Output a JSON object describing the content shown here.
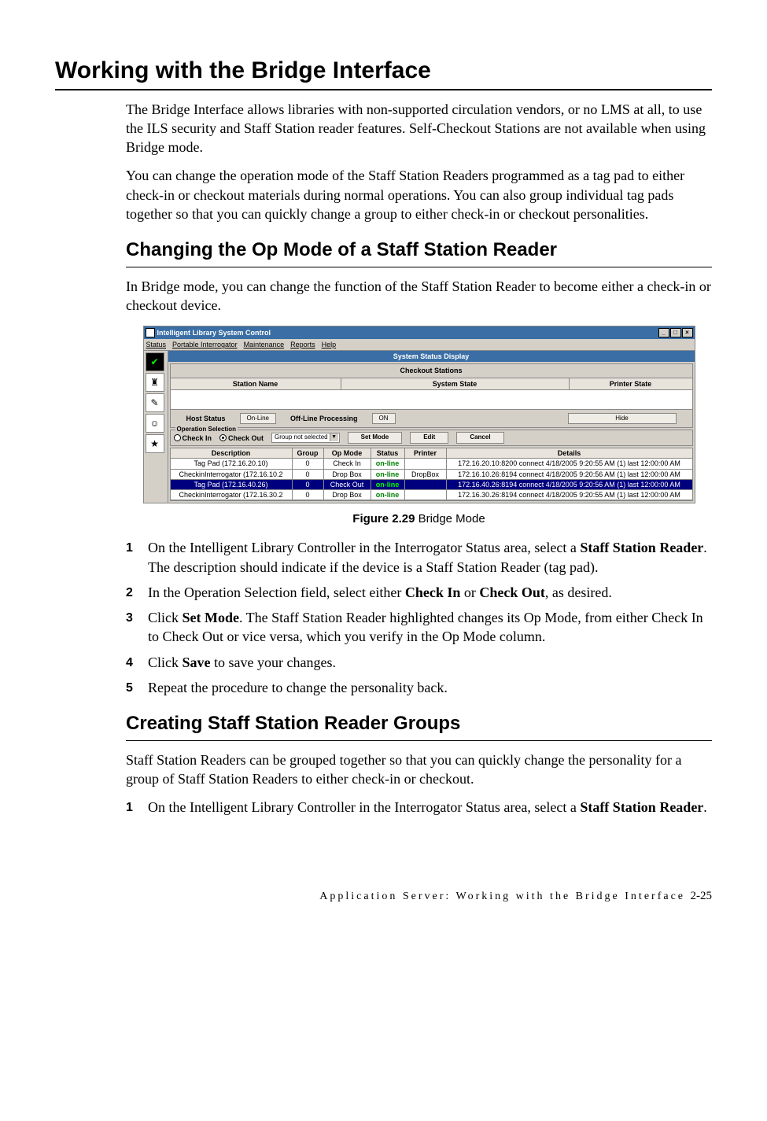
{
  "h1": "Working with the Bridge Interface",
  "intro1": "The Bridge Interface allows libraries with non-supported circulation vendors, or no LMS at all, to use the ILS security and Staff Station reader features. Self-Checkout Stations are not available when using Bridge mode.",
  "intro2": "You can change the operation mode of the Staff Station Readers programmed as a tag pad to either check-in or checkout materials during normal operations. You can also group individual tag pads together so that you can quickly change a group to either check-in or checkout personalities.",
  "h2a": "Changing the Op Mode of a Staff Station Reader",
  "h2a_intro": "In Bridge mode, you can change the function of the Staff Station Reader to become either a check-in or checkout device.",
  "fig_caption_bold": "Figure 2.29",
  "fig_caption_rest": " Bridge Mode",
  "steps_a": {
    "s1a": "On the Intelligent Library Controller in the Interrogator Status area, select a ",
    "s1b": "Staff Station Reader",
    "s1c": ". The description should indicate if the device is a Staff Station Reader (tag pad).",
    "s2a": "In the Operation Selection field, select either ",
    "s2b": "Check In",
    "s2c": " or ",
    "s2d": "Check Out",
    "s2e": ", as desired.",
    "s3a": "Click ",
    "s3b": "Set Mode",
    "s3c": ". The Staff Station Reader highlighted changes its Op Mode, from either Check In to Check Out or vice versa, which you verify in the Op Mode column.",
    "s4a": "Click ",
    "s4b": "Save",
    "s4c": " to save your changes.",
    "s5": "Repeat the procedure to change the personality back."
  },
  "h2b": "Creating Staff Station Reader Groups",
  "h2b_intro": "Staff Station Readers can be grouped together so that you can quickly change the personality for a group of Staff Station Readers to either check-in or checkout.",
  "steps_b": {
    "s1a": "On the Intelligent Library Controller in the Interrogator Status area, select a ",
    "s1b": "Staff Station Reader",
    "s1c": "."
  },
  "footer_text": "Application Server: Working with the Bridge Interface",
  "footer_page": "2-25",
  "shot": {
    "title": "Intelligent Library System Control",
    "menus": [
      "Status",
      "Portable Interrogator",
      "Maintenance",
      "Reports",
      "Help"
    ],
    "ssd": "System Status Display",
    "chk_title": "Checkout Stations",
    "hdrs": {
      "c1": "Station Name",
      "c2": "System State",
      "c3": "Printer State"
    },
    "host_status": "Host Status",
    "online": "On-Line",
    "off_proc": "Off-Line Processing",
    "on": "ON",
    "hide": "Hide",
    "opsel_legend": "Operation Selection",
    "check_in": "Check In",
    "check_out": "Check Out",
    "combo": "Group not selected",
    "set_mode": "Set Mode",
    "edit": "Edit",
    "cancel": "Cancel",
    "th": {
      "d": "Description",
      "g": "Group",
      "o": "Op Mode",
      "s": "Status",
      "p": "Printer",
      "dt": "Details"
    },
    "rows": [
      {
        "d": "Tag Pad (172.16.20.10)",
        "g": "0",
        "o": "Check In",
        "s": "on-line",
        "p": "",
        "dt": "172.16.20.10:8200 connect 4/18/2005 9:20:55 AM (1) last 12:00:00 AM"
      },
      {
        "d": "CheckinInterrogator (172.16.10.2",
        "g": "0",
        "o": "Drop Box",
        "s": "on-line",
        "p": "DropBox",
        "dt": "172.16.10.26:8194 connect 4/18/2005 9:20:56 AM (1) last 12:00:00 AM"
      },
      {
        "d": "Tag Pad (172.16.40.26)",
        "g": "0",
        "o": "Check Out",
        "s": "on-line",
        "p": "",
        "dt": "172.16.40.26:8194 connect 4/18/2005 9:20:56 AM (1) last 12:00:00 AM",
        "sel": true
      },
      {
        "d": "CheckinInterrogator (172.16.30.2",
        "g": "0",
        "o": "Drop Box",
        "s": "on-line",
        "p": "",
        "dt": "172.16.30.26:8194 connect 4/18/2005 9:20:55 AM (1) last 12:00:00 AM"
      }
    ]
  }
}
